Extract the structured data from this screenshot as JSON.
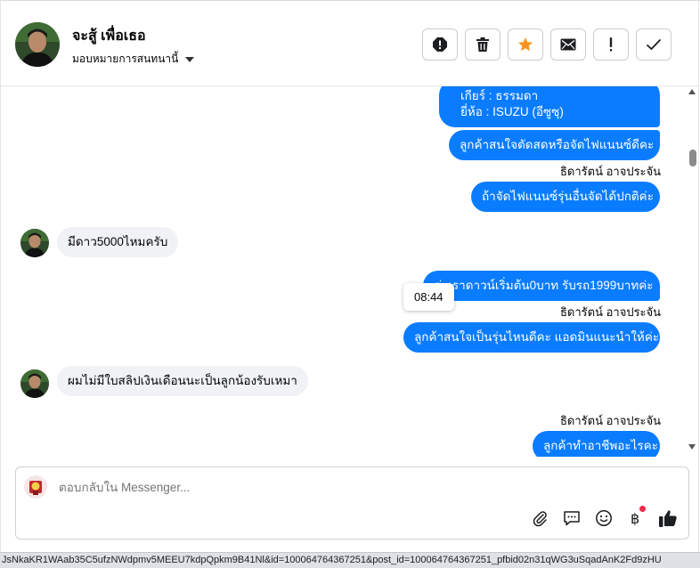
{
  "header": {
    "contact_name": "จะสู้ เพื่อเธอ",
    "assign_label": "มอบหมายการสนทนานี้",
    "toolbar_icons": [
      "alert-icon",
      "trash-icon",
      "star-icon",
      "mail-icon",
      "exclamation-icon",
      "check-icon"
    ]
  },
  "messages": {
    "out_spec_gear": "เกียร์ : ธรรมดา",
    "out_spec_brand": "ยี่ห้อ : ISUZU (อีซูซุ)",
    "out_msg_1": "ลูกค้าสนใจตัดสดหรือจัดไฟแนนซ์ดีคะ",
    "sender_1": "ธิดารัตน์ อาจประจัน",
    "out_msg_2": "ถ้าจัดไฟแนนซ์รุ่นอื่นจัดได้ปกติค่ะ",
    "in_msg_1": "มีดาว5000ไหมครับ",
    "out_msg_3": "ค่ะเราดาวน์เริ่มต้น0บาท รับรถ1999บาทค่ะ",
    "tooltip_time": "08:44",
    "sender_2": "ธิดารัตน์ อาจประจัน",
    "out_msg_4": "ลูกค้าสนใจเป็นรุ่นไหนดีคะ แอดมินแนะนำให้ค่ะ",
    "in_msg_2": "ผมไม่มีใบสลิปเงินเดือนนะเป็นลูกน้องรับเหมา",
    "sender_3": "ธิดารัตน์ อาจประจัน",
    "out_msg_5": "ลูกค้าทำอาชีพอะไรคะ"
  },
  "composer": {
    "placeholder": "ตอบกลับใน Messenger...",
    "tool_icons": [
      "attach-icon",
      "saved-reply-icon",
      "emoji-icon",
      "baht-icon",
      "thumbs-up-icon"
    ]
  },
  "statusbar": {
    "url": "JsNkaKR1WAab35C5ufzNWdpmv5MEEU7kdpQpkm9B41Nl&id=100064764367251&post_id=100064764367251_pfbid02n31qWG3uSqadAnK2Fd9zHU"
  },
  "colors": {
    "accent": "#0a7cff",
    "star": "#f7931e",
    "incoming_bg": "#f0f2f5"
  }
}
